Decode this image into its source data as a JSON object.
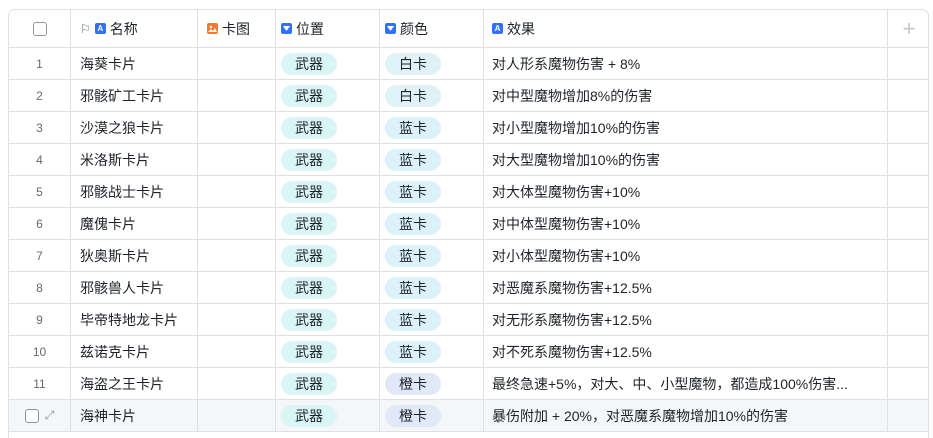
{
  "header": {
    "name": "名称",
    "image": "卡图",
    "position": "位置",
    "color": "颜色",
    "effect": "效果",
    "add": "+"
  },
  "icons": {
    "primary_field": "flag-icon",
    "text_field": "A",
    "image_field": "image-icon",
    "select_field": "single-select-icon"
  },
  "rows": [
    {
      "idx": "1",
      "name": "海葵卡片",
      "position": "武器",
      "color": "白卡",
      "effect": "对人形系魔物伤害 + 8%"
    },
    {
      "idx": "2",
      "name": "邪骸矿工卡片",
      "position": "武器",
      "color": "白卡",
      "effect": "对中型魔物增加8%的伤害"
    },
    {
      "idx": "3",
      "name": "沙漠之狼卡片",
      "position": "武器",
      "color": "蓝卡",
      "effect": "对小型魔物增加10%的伤害"
    },
    {
      "idx": "4",
      "name": "米洛斯卡片",
      "position": "武器",
      "color": "蓝卡",
      "effect": "对大型魔物增加10%的伤害"
    },
    {
      "idx": "5",
      "name": "邪骸战士卡片",
      "position": "武器",
      "color": "蓝卡",
      "effect": "对大体型魔物伤害+10%"
    },
    {
      "idx": "6",
      "name": "魔傀卡片",
      "position": "武器",
      "color": "蓝卡",
      "effect": "对中体型魔物伤害+10%"
    },
    {
      "idx": "7",
      "name": "狄奥斯卡片",
      "position": "武器",
      "color": "蓝卡",
      "effect": "对小体型魔物伤害+10%"
    },
    {
      "idx": "8",
      "name": "邪骸兽人卡片",
      "position": "武器",
      "color": "蓝卡",
      "effect": "对恶魔系魔物伤害+12.5%"
    },
    {
      "idx": "9",
      "name": "毕帝特地龙卡片",
      "position": "武器",
      "color": "蓝卡",
      "effect": "对无形系魔物伤害+12.5%"
    },
    {
      "idx": "10",
      "name": "兹诺克卡片",
      "position": "武器",
      "color": "蓝卡",
      "effect": "对不死系魔物伤害+12.5%"
    },
    {
      "idx": "11",
      "name": "海盗之王卡片",
      "position": "武器",
      "color": "橙卡",
      "effect": "最终急速+5%，对大、中、小型魔物，都造成100%伤害..."
    },
    {
      "idx": "",
      "name": "海神卡片",
      "position": "武器",
      "color": "橙卡",
      "effect": "暴伤附加 + 20%，对恶魔系魔物增加10%的伤害"
    }
  ],
  "colors": {
    "border": "#dee0e3",
    "tag_position_bg": "#d9f5f6",
    "tag_white_bg": "#dff2f7",
    "tag_blue_bg": "#dcf2fb",
    "tag_orange_bg": "#e1e9f8",
    "accent": "#3370ff",
    "image_accent": "#f07b2c",
    "hover_row": "#f5f6f7"
  }
}
